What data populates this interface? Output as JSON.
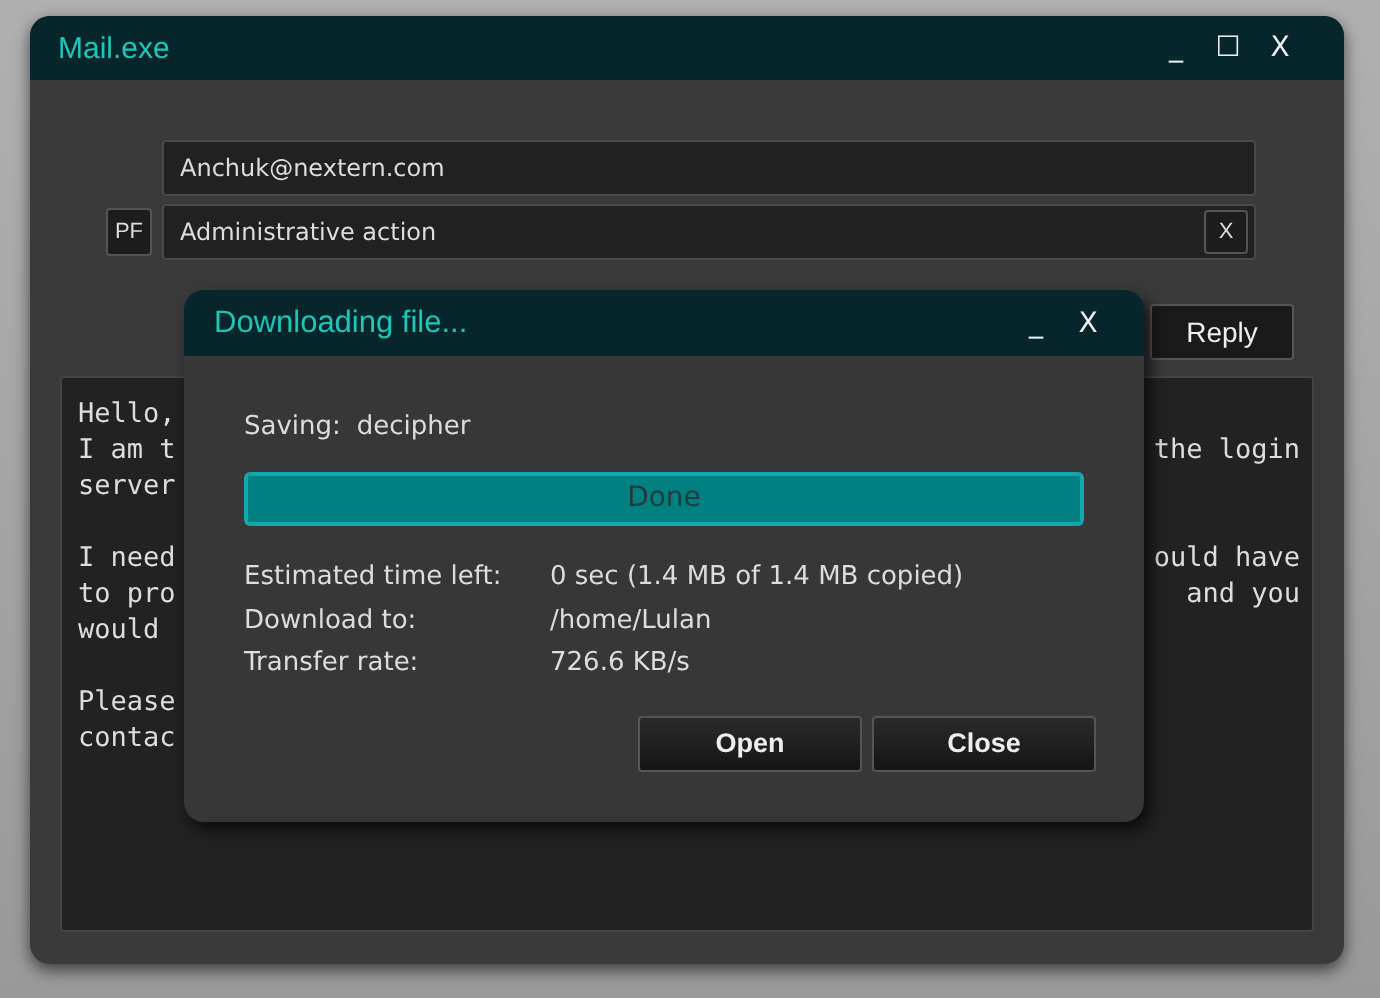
{
  "window": {
    "title": "Mail.exe",
    "controls": [
      "_",
      "☐",
      "X"
    ]
  },
  "to_field": {
    "value": "Anchuk@nextern.com"
  },
  "pf_button": "PF",
  "subject_field": {
    "value": "Administrative action",
    "clear_button": "X"
  },
  "reply_button": "Reply",
  "body": {
    "paragraphs": [
      {
        "lines": [
          {
            "left": "Hello,"
          },
          {
            "left": "I am t",
            "right": "the login"
          },
          {
            "left": "server"
          }
        ]
      },
      {
        "lines": [
          {
            "left": "I need",
            "right": "ould have"
          },
          {
            "left": "to pro",
            "right": "and you"
          },
          {
            "left": "would"
          }
        ]
      },
      {
        "lines": [
          {
            "left": "Please"
          },
          {
            "left": "contac"
          }
        ]
      }
    ]
  },
  "dialog": {
    "title": "Downloading file...",
    "controls": [
      "_",
      "X"
    ],
    "saving_label": "Saving:",
    "saving_value": "decipher",
    "progress": {
      "level": 1,
      "label": "Done"
    },
    "details": [
      {
        "label": "Estimated time left:",
        "value": "0 sec (1.4 MB of 1.4 MB copied)"
      },
      {
        "label": "Download to:",
        "value": "/home/Lulan"
      },
      {
        "label": "Transfer rate:",
        "value": "726.6 KB/s"
      }
    ],
    "buttons": [
      "Open",
      "Close"
    ]
  }
}
